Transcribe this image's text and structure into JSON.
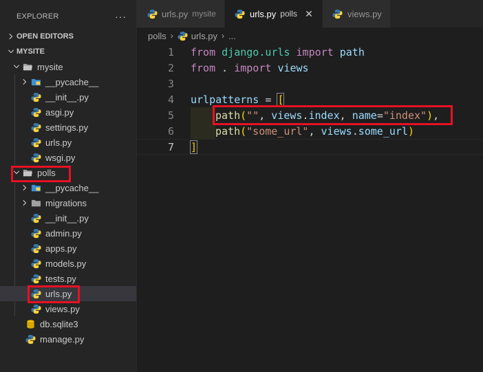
{
  "sidebar": {
    "title": "EXPLORER",
    "more": "···",
    "open_editors": "OPEN EDITORS",
    "project": "MYSITE",
    "items": [
      {
        "label": "mysite",
        "kind": "folder-open"
      },
      {
        "label": "__pycache__",
        "kind": "folder-py"
      },
      {
        "label": "__init__.py",
        "kind": "python"
      },
      {
        "label": "asgi.py",
        "kind": "python"
      },
      {
        "label": "settings.py",
        "kind": "python"
      },
      {
        "label": "urls.py",
        "kind": "python"
      },
      {
        "label": "wsgi.py",
        "kind": "python"
      },
      {
        "label": "polls",
        "kind": "folder-open"
      },
      {
        "label": "__pycache__",
        "kind": "folder-py"
      },
      {
        "label": "migrations",
        "kind": "folder"
      },
      {
        "label": "__init__.py",
        "kind": "python"
      },
      {
        "label": "admin.py",
        "kind": "python"
      },
      {
        "label": "apps.py",
        "kind": "python"
      },
      {
        "label": "models.py",
        "kind": "python"
      },
      {
        "label": "tests.py",
        "kind": "python"
      },
      {
        "label": "urls.py",
        "kind": "python"
      },
      {
        "label": "views.py",
        "kind": "python"
      },
      {
        "label": "db.sqlite3",
        "kind": "database"
      },
      {
        "label": "manage.py",
        "kind": "python"
      }
    ]
  },
  "tabs": [
    {
      "label": "urls.py",
      "description": "mysite",
      "active": false
    },
    {
      "label": "urls.py",
      "description": "polls",
      "active": true,
      "close": "✕"
    },
    {
      "label": "views.py",
      "description": "",
      "active": false
    }
  ],
  "breadcrumb": {
    "folder": "polls",
    "file": "urls.py",
    "more": "..."
  },
  "editor": {
    "line_numbers": [
      "1",
      "2",
      "3",
      "4",
      "5",
      "6",
      "7"
    ],
    "line1": {
      "kw1": "from",
      "mod": "django.urls",
      "kw2": "import",
      "name": "path"
    },
    "line2": {
      "kw1": "from",
      "mod": ".",
      "kw2": "import",
      "name": "views"
    },
    "line4": {
      "var": "urlpatterns",
      "op": " = ",
      "bracket": "["
    },
    "line5": {
      "fn": "path",
      "open": "(",
      "str1": "\"\"",
      "comma1": ", ",
      "obj": "views",
      "dot": ".",
      "attr": "index",
      "comma2": ", ",
      "kwarg": "name",
      "eq": "=",
      "str2": "\"index\"",
      "close": ")",
      "comma3": ","
    },
    "line6": {
      "fn": "path",
      "open": "(",
      "str1": "\"some_url\"",
      "comma1": ", ",
      "obj": "views",
      "dot": ".",
      "attr": "some_url",
      "close": ")"
    },
    "line7": {
      "bracket": "]"
    }
  },
  "colors": {
    "highlight": "#e81123",
    "python_blue": "#3776ab",
    "python_yellow": "#ffd43b"
  }
}
